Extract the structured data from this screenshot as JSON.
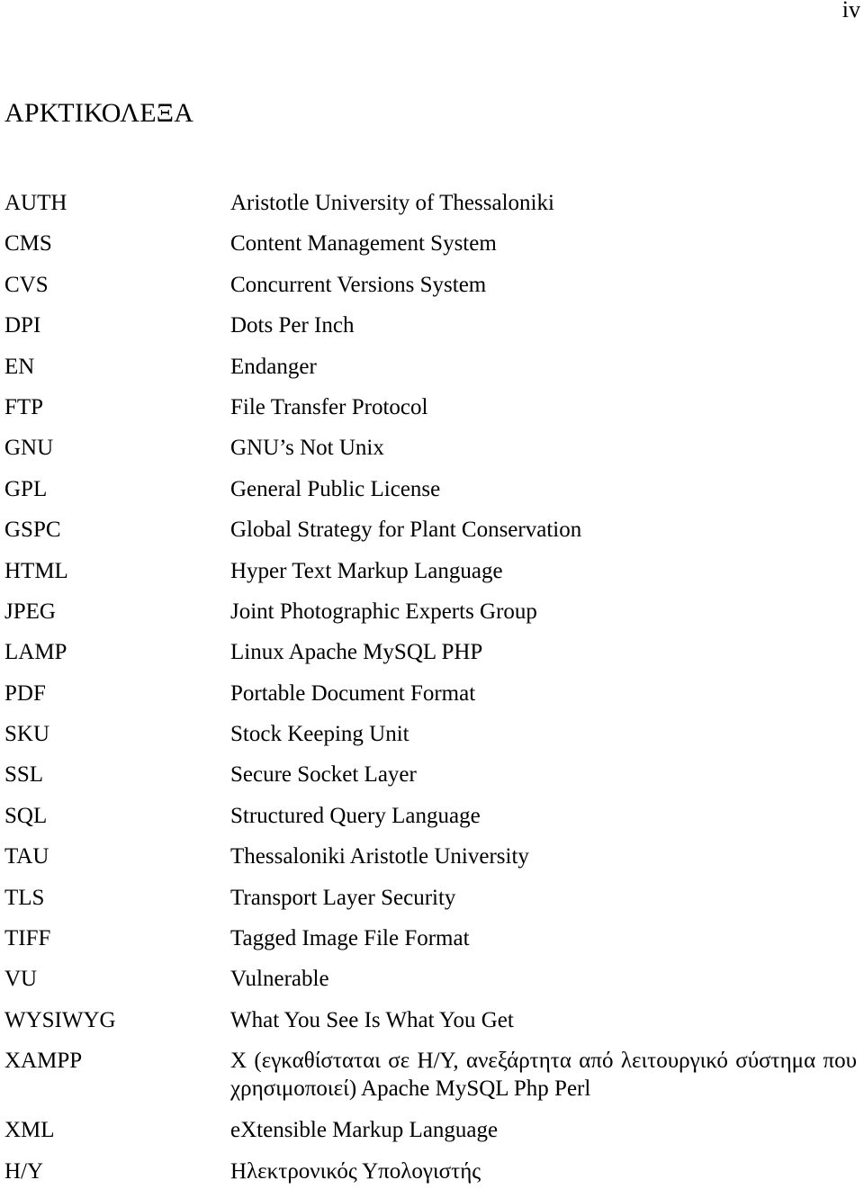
{
  "page": {
    "number": "iv",
    "title": "ΑΡΚΤΙΚΟΛΕΞΑ"
  },
  "abbreviations": [
    {
      "term": "AUTH",
      "definition": "Aristotle University of Thessaloniki"
    },
    {
      "term": "CMS",
      "definition": "Content Management System"
    },
    {
      "term": "CVS",
      "definition": "Concurrent Versions System"
    },
    {
      "term": "DPI",
      "definition": "Dots Per Inch"
    },
    {
      "term": "EN",
      "definition": "Endanger"
    },
    {
      "term": "FTP",
      "definition": "File Transfer Protocol"
    },
    {
      "term": "GNU",
      "definition": "GNU’s Not Unix"
    },
    {
      "term": "GPL",
      "definition": "General Public License"
    },
    {
      "term": "GSPC",
      "definition": "Global Strategy for Plant Conservation"
    },
    {
      "term": "HTML",
      "definition": "Hyper Text Markup Language"
    },
    {
      "term": "JPEG",
      "definition": "Joint Photographic Experts Group"
    },
    {
      "term": "LAMP",
      "definition": "Linux Apache MySQL PHP"
    },
    {
      "term": "PDF",
      "definition": "Portable Document Format"
    },
    {
      "term": "SKU",
      "definition": "Stock Keeping Unit"
    },
    {
      "term": "SSL",
      "definition": "Secure Socket Layer"
    },
    {
      "term": "SQL",
      "definition": "Structured Query Language"
    },
    {
      "term": "TAU",
      "definition": "Thessaloniki Aristotle University"
    },
    {
      "term": "TLS",
      "definition": "Transport Layer Security"
    },
    {
      "term": "TIFF",
      "definition": "Tagged Image File Format"
    },
    {
      "term": "VU",
      "definition": "Vulnerable"
    },
    {
      "term": "WYSIWYG",
      "definition": "What You See Is What You Get"
    },
    {
      "term": "XAMPP",
      "definition": "X (εγκαθίσταται σε Η/Υ, ανεξάρτητα από λειτουργικό σύστημα που χρησιμοποιεί) Apache MySQL Php Perl"
    },
    {
      "term": "XML",
      "definition": "eXtensible Markup Language"
    },
    {
      "term": "H/Y",
      "definition": "Ηλεκτρονικός Υπολογιστής"
    }
  ]
}
